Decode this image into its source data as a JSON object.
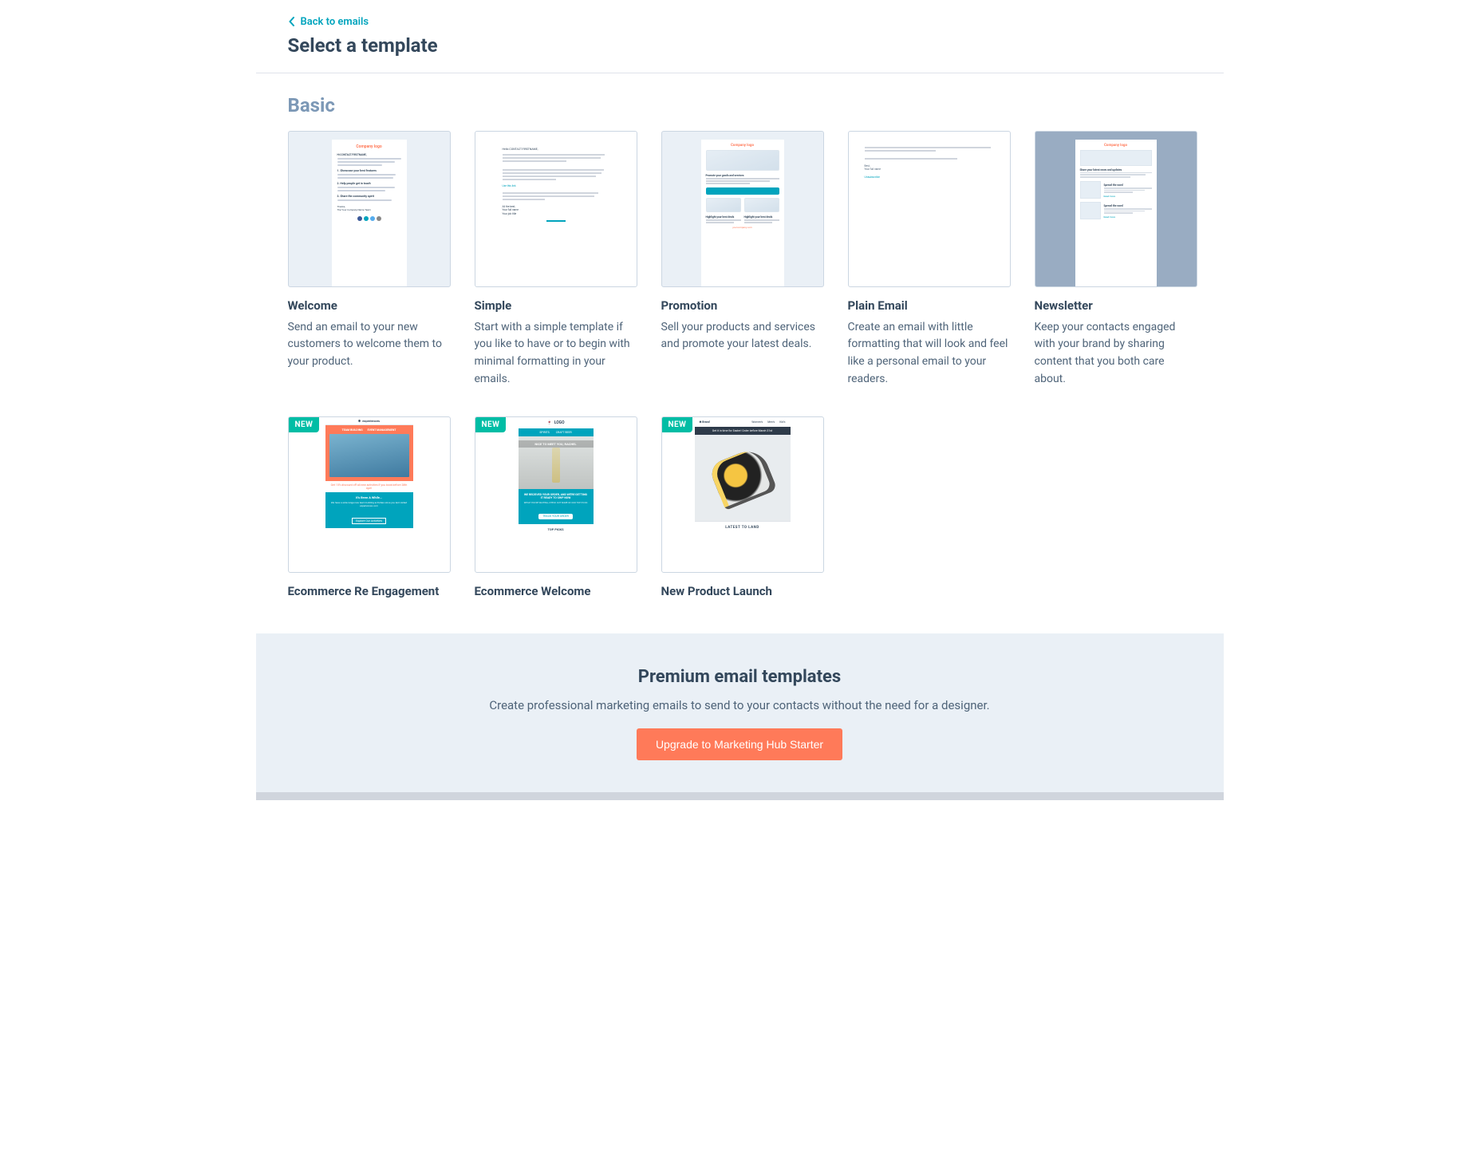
{
  "back_label": "Back to emails",
  "page_title": "Select a template",
  "section_title": "Basic",
  "new_badge": "NEW",
  "templates": [
    {
      "title": "Welcome",
      "desc": "Send an email to your new customers to welcome them to your product."
    },
    {
      "title": "Simple",
      "desc": "Start with a simple template if you like to have or to begin with minimal formatting in your emails."
    },
    {
      "title": "Promotion",
      "desc": "Sell your products and services and promote your latest deals."
    },
    {
      "title": "Plain Email",
      "desc": "Create an email with little formatting that will look and feel like a personal email to your readers."
    },
    {
      "title": "Newsletter",
      "desc": "Keep your contacts engaged with your brand by sharing content that you both care about."
    },
    {
      "title": "Ecommerce Re Engagement",
      "desc": ""
    },
    {
      "title": "Ecommerce Welcome",
      "desc": ""
    },
    {
      "title": "New Product Launch",
      "desc": ""
    }
  ],
  "thumbs": {
    "company_logo": "Company logo",
    "promotion": {
      "heading": "Promote your goods and services",
      "sub1": "Highlight your best deals",
      "sub2": "Highlight your best deals"
    },
    "newsletter": {
      "heading": "Share your latest news and updates",
      "subheading": "Spread the word"
    },
    "ecr": {
      "brand": "experiences",
      "tag1": "TEAM BUILDING",
      "tag2": "EVENT MANAGEMENT",
      "discount": "Get 15% discount off all new activities if you book before 28th April",
      "band_title": "It's Been A While…",
      "band_sub": "We have a wide range new team building activities since you last visited experiences.com",
      "band_btn": "Explore Our Activities"
    },
    "ecw": {
      "brand": "LOGO",
      "nav1": "SPIRITS",
      "nav2": "CRAFT BEER",
      "hero": "NICE TO MEET YOU, RACHEL",
      "green_line1": "WE RECEIVED YOUR ORDER, AND WE'RE GETTING IT READY TO SHIP NOW",
      "green_btn": "TRACK YOUR ORDER",
      "picks": "TOP PICKS"
    },
    "npl": {
      "cat1": "Women's",
      "cat2": "Men's",
      "cat3": "Kid's",
      "banner": "Get it in time for Easter! Order before March 31st",
      "latest": "LATEST TO LAND"
    }
  },
  "premium": {
    "title": "Premium email templates",
    "sub": "Create professional marketing emails to send to your contacts without the need for a designer.",
    "cta": "Upgrade to Marketing Hub Starter"
  }
}
